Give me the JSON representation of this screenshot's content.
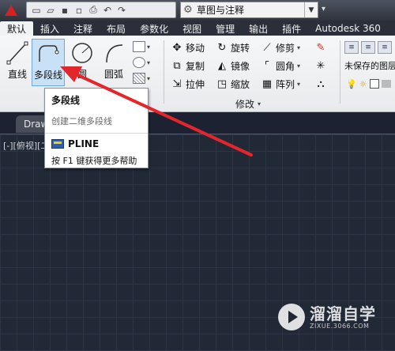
{
  "quick_access": {
    "workspace": "草图与注释",
    "icons": [
      "new-icon",
      "open-icon",
      "save-icon",
      "save-as-icon",
      "print-icon",
      "undo-icon",
      "redo-icon"
    ]
  },
  "ribbon_tabs": [
    {
      "label": "默认",
      "active": true
    },
    {
      "label": "插入",
      "active": false
    },
    {
      "label": "注释",
      "active": false
    },
    {
      "label": "布局",
      "active": false
    },
    {
      "label": "参数化",
      "active": false
    },
    {
      "label": "视图",
      "active": false
    },
    {
      "label": "管理",
      "active": false
    },
    {
      "label": "输出",
      "active": false
    },
    {
      "label": "插件",
      "active": false
    },
    {
      "label": "Autodesk 360",
      "active": false
    }
  ],
  "draw_panel": {
    "line": "直线",
    "polyline": "多段线",
    "circle": "圆",
    "arc": "圆弧"
  },
  "modify_panel": {
    "title": "修改",
    "items": [
      {
        "label": "移动",
        "icon": "move-icon"
      },
      {
        "label": "旋转",
        "icon": "rotate-icon"
      },
      {
        "label": "修剪",
        "icon": "trim-icon"
      },
      {
        "label": "复制",
        "icon": "copy-icon"
      },
      {
        "label": "镜像",
        "icon": "mirror-icon"
      },
      {
        "label": "圆角",
        "icon": "fillet-icon"
      },
      {
        "label": "拉伸",
        "icon": "stretch-icon"
      },
      {
        "label": "缩放",
        "icon": "scale-icon"
      },
      {
        "label": "阵列",
        "icon": "array-icon"
      }
    ]
  },
  "layers_panel": {
    "layer_state": "未保存的图层"
  },
  "document": {
    "tab": "Draw",
    "viewport_label": "[-][俯视][二"
  },
  "tooltip": {
    "title": "多段线",
    "description": "创建二维多段线",
    "command": "PLINE",
    "help": "按 F1 键获得更多帮助"
  },
  "watermark": {
    "name": "溜溜自学",
    "url": "ZIXUE.3066.COM"
  },
  "colors": {
    "canvas_bg": "#212836",
    "arrow": "#e3262b",
    "ribbon_bg": "#f0f2f4",
    "app_red": "#d32222"
  }
}
